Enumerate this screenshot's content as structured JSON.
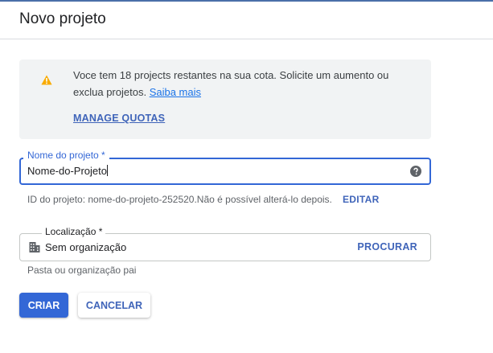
{
  "header": {
    "title": "Novo projeto"
  },
  "quota": {
    "message": "Voce tem 18 projects restantes na sua cota. Solicite um aumento ou exclua projetos.",
    "learn_more": "Saiba mais",
    "manage_label": "MANAGE QUOTAS",
    "icon": "warning-icon"
  },
  "project_name": {
    "label": "Nome do projeto *",
    "value": "Nome-do-Projeto",
    "icon": "help-icon"
  },
  "project_id": {
    "text": "ID do projeto: nome-do-projeto-252520.Não é possível alterá-lo depois.",
    "edit_label": "EDITAR"
  },
  "location": {
    "label": "Localização *",
    "value": "Sem organização",
    "search_label": "PROCURAR",
    "hint": "Pasta ou organização pai",
    "icon": "building-icon"
  },
  "actions": {
    "create_label": "CRIAR",
    "cancel_label": "CANCELAR"
  },
  "colors": {
    "accent": "#3367d6",
    "link": "#3f64b9",
    "warning": "#f9ab00",
    "quota_background": "#f1f3f4"
  }
}
